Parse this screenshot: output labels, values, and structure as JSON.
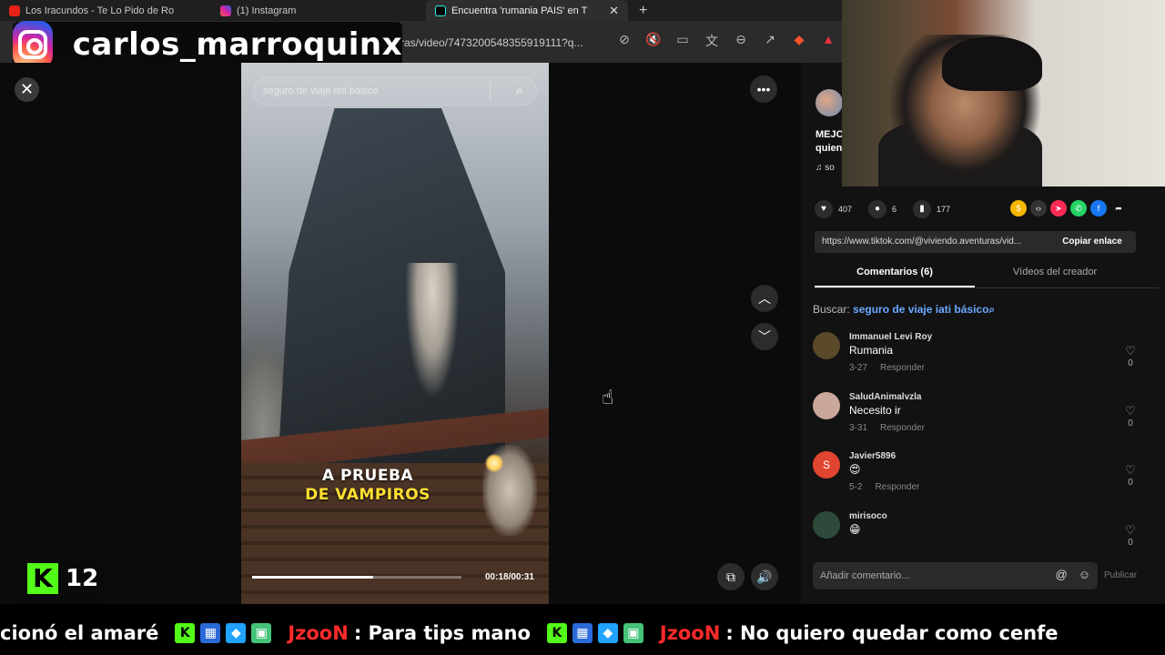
{
  "browser": {
    "tabs": [
      {
        "label": "Los Iracundos - Te Lo Pido de Ro",
        "icon": "youtube-icon"
      },
      {
        "label": "(1) Instagram",
        "icon": "instagram-icon"
      },
      {
        "label": "Encuentra 'rumania PAIS' en T",
        "icon": "tiktok-icon"
      }
    ],
    "new_tab": "+",
    "tab_close": "✕",
    "url": "ras/video/7473200548355919111?q..."
  },
  "overlay": {
    "instagram_handle": "carlos_marroquinx",
    "kick_count": "12",
    "kick_logo": "K"
  },
  "video": {
    "search_placeholder": "seguro de viaje iati básico",
    "caption_line1": "A PRUEBA",
    "caption_line2": "DE VAMPIROS",
    "time": "00:18/00:31",
    "progress_fraction": 0.58
  },
  "side": {
    "desc_line1": "MEJC",
    "desc_line2": "quien",
    "music": "♫ so",
    "likes": "407",
    "comments": "6",
    "saves": "177",
    "link": "https://www.tiktok.com/@viviendo.aventuras/vid...",
    "copy_label": "Copiar enlace",
    "tab_comments": "Comentarios (6)",
    "tab_creator": "Vídeos del creador",
    "buscar_label": "Buscar:",
    "buscar_query": "seguro de viaje iati básico",
    "comments_list": [
      {
        "name": "Immanuel Levi Roy",
        "text": "Rumania",
        "date": "3-27",
        "reply": "Responder",
        "likes": "0"
      },
      {
        "name": "SaludAnimalvzla",
        "text": "Necesito ir",
        "date": "3-31",
        "reply": "Responder",
        "likes": "0"
      },
      {
        "name": "Javier5896",
        "text": "😍",
        "date": "5-2",
        "reply": "Responder",
        "likes": "0",
        "initial": "S"
      },
      {
        "name": "mirisoco",
        "text": "😁",
        "date": "",
        "reply": "",
        "likes": "0"
      }
    ],
    "add_comment_placeholder": "Añadir comentario...",
    "publish_label": "Publicar"
  },
  "ticker": {
    "msg0": "cionó el amaré",
    "user1": "JzooN",
    "msg1": ": Para tips mano",
    "user2": "JzooN",
    "msg2": ": No quiero quedar como cenfe"
  },
  "colors": {
    "kick_green": "#53fc18",
    "tiktok_blue": "#6ba8ff",
    "ticker_user": "#ff2a2a",
    "caption_yellow": "#ffe033"
  }
}
